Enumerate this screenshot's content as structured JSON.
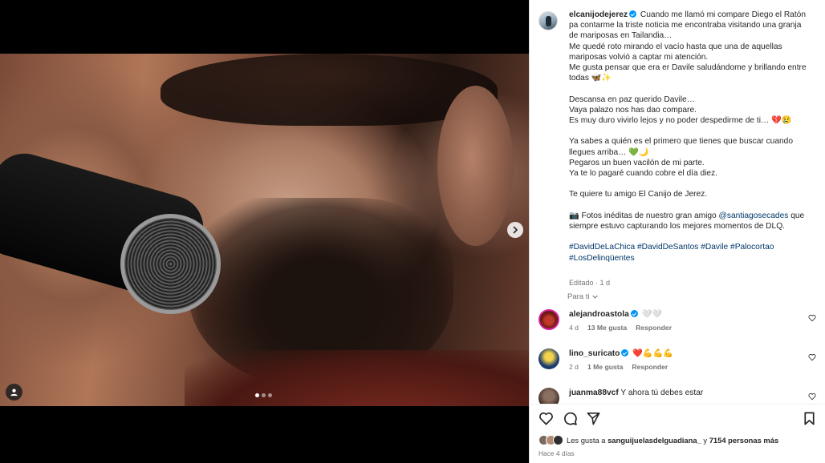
{
  "post": {
    "author": "elcanijodejerez",
    "caption_lines": [
      "Cuando me llamó mi compare Diego el Ratón pa contarme la triste noticia me encontraba visitando una granja de mariposas en Tailandia…",
      "Me quedé roto mirando el vacío hasta que una de aquellas mariposas volvió a captar mi atención.",
      "Me gusta pensar que era er Davile saludándome y brillando entre todas 🦋✨",
      "",
      "Descansa en paz querido Davile…",
      "Vaya palazo nos has dao compare.",
      "Es muy duro vivirlo lejos y no poder despedirme de ti… 💔😢",
      "",
      "Ya sabes a quién es el primero que tienes que buscar cuando llegues arriba… 💚🌙",
      "Pegaros un buen vacilón de mi parte.",
      "Ya te lo pagaré cuando cobre el día diez.",
      "",
      "Te quiere tu amigo El Canijo de Jerez.",
      ""
    ],
    "photos_prefix": "📷 Fotos inéditas de nuestro gran amigo ",
    "photos_mention": "@santiagosecades",
    "photos_suffix": " que siempre estuvo capturando los mejores momentos de DLQ.",
    "hashtags": "#DavidDeLaChica #DavidDeSantos #Davile #Palocortao #LosDelinqüentes",
    "edited": "Editado · 1 d",
    "translate": "Para ti"
  },
  "comments": [
    {
      "user": "alejandroastola",
      "verified": true,
      "text": "🤍🤍",
      "age": "4 d",
      "likes": "13 Me gusta",
      "reply": "Responder"
    },
    {
      "user": "lino_suricato",
      "verified": true,
      "text": "❤️💪💪💪",
      "age": "2 d",
      "likes": "1 Me gusta",
      "reply": "Responder"
    },
    {
      "user": "juanma88vcf",
      "verified": false,
      "text": "Y ahora tú debes estar"
    }
  ],
  "footer": {
    "likes_prefix": "Les gusta a ",
    "likes_user": "sanguijuelasdelguadiana_",
    "likes_mid": " y ",
    "likes_count": "7154 personas más",
    "time_ago": "Hace 4 días"
  },
  "carousel": {
    "count": 3,
    "active": 0
  },
  "icons": [
    "next-arrow-icon",
    "user-tag-icon",
    "heart-icon",
    "comment-icon",
    "share-icon",
    "bookmark-icon",
    "chevron-down-icon"
  ],
  "colors": {
    "link": "#00376b",
    "verified": "#0095f6",
    "meta": "#737373"
  }
}
